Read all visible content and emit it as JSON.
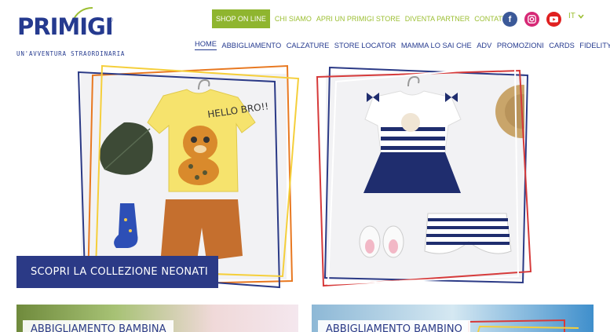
{
  "brand": {
    "name": "PRIMIGI",
    "tagline": "UN'AVVENTURA STRAORDINARIA",
    "colors": {
      "navy": "#253a8f",
      "green": "#8fb52f",
      "cta": "#2b3a86"
    }
  },
  "topnav": {
    "shop": "SHOP ON LINE",
    "links": [
      "CHI SIAMO",
      "APRI UN PRIMIGI STORE",
      "DIVENTA PARTNER",
      "CONTATTI"
    ]
  },
  "social": [
    "facebook-icon",
    "instagram-icon",
    "youtube-icon"
  ],
  "language": "IT",
  "mainnav": [
    "HOME",
    "ABBIGLIAMENTO",
    "CALZATURE",
    "STORE LOCATOR",
    "MAMMA LO SAI CHE",
    "ADV",
    "PROMOZIONI",
    "CARDS",
    "FIDELITY CARD"
  ],
  "hero": {
    "left_shirt_text": "HELLO BRO!!",
    "cta": "SCOPRI LA COLLEZIONE NEONATI"
  },
  "tiles": [
    "ABBIGLIAMENTO BAMBINA",
    "ABBIGLIAMENTO BAMBINO"
  ]
}
